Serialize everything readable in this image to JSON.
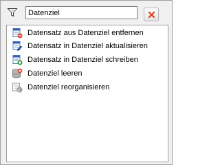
{
  "search": {
    "value": "Datenziel",
    "placeholder": ""
  },
  "icons": {
    "filter": "filter-funnel-icon",
    "clear": "clear-x-icon"
  },
  "colors": {
    "clear_x": "#e8401c",
    "accent_blue": "#2f62b8"
  },
  "list": {
    "items": [
      {
        "label": "Datensatz aus Datenziel entfernen",
        "icon": "record-remove-icon"
      },
      {
        "label": "Datensatz in Datenziel aktualisieren",
        "icon": "record-update-icon"
      },
      {
        "label": "Datensatz in Datenziel schreiben",
        "icon": "record-write-icon"
      },
      {
        "label": "Datenziel leeren",
        "icon": "database-clear-icon"
      },
      {
        "label": "Datenziel reorganisieren",
        "icon": "database-reorganize-icon"
      }
    ]
  }
}
